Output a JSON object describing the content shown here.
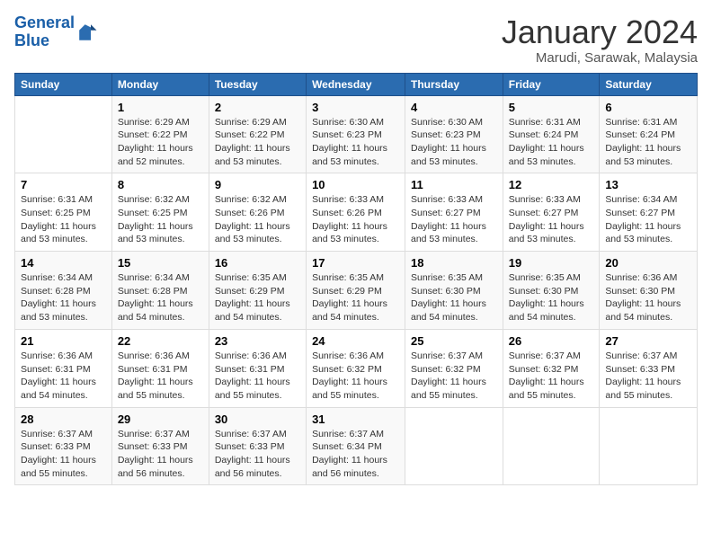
{
  "logo": {
    "line1": "General",
    "line2": "Blue"
  },
  "title": "January 2024",
  "subtitle": "Marudi, Sarawak, Malaysia",
  "weekdays": [
    "Sunday",
    "Monday",
    "Tuesday",
    "Wednesday",
    "Thursday",
    "Friday",
    "Saturday"
  ],
  "weeks": [
    [
      {
        "day": "",
        "info": ""
      },
      {
        "day": "1",
        "info": "Sunrise: 6:29 AM\nSunset: 6:22 PM\nDaylight: 11 hours\nand 52 minutes."
      },
      {
        "day": "2",
        "info": "Sunrise: 6:29 AM\nSunset: 6:22 PM\nDaylight: 11 hours\nand 53 minutes."
      },
      {
        "day": "3",
        "info": "Sunrise: 6:30 AM\nSunset: 6:23 PM\nDaylight: 11 hours\nand 53 minutes."
      },
      {
        "day": "4",
        "info": "Sunrise: 6:30 AM\nSunset: 6:23 PM\nDaylight: 11 hours\nand 53 minutes."
      },
      {
        "day": "5",
        "info": "Sunrise: 6:31 AM\nSunset: 6:24 PM\nDaylight: 11 hours\nand 53 minutes."
      },
      {
        "day": "6",
        "info": "Sunrise: 6:31 AM\nSunset: 6:24 PM\nDaylight: 11 hours\nand 53 minutes."
      }
    ],
    [
      {
        "day": "7",
        "info": ""
      },
      {
        "day": "8",
        "info": "Sunrise: 6:32 AM\nSunset: 6:25 PM\nDaylight: 11 hours\nand 53 minutes."
      },
      {
        "day": "9",
        "info": "Sunrise: 6:32 AM\nSunset: 6:26 PM\nDaylight: 11 hours\nand 53 minutes."
      },
      {
        "day": "10",
        "info": "Sunrise: 6:33 AM\nSunset: 6:26 PM\nDaylight: 11 hours\nand 53 minutes."
      },
      {
        "day": "11",
        "info": "Sunrise: 6:33 AM\nSunset: 6:27 PM\nDaylight: 11 hours\nand 53 minutes."
      },
      {
        "day": "12",
        "info": "Sunrise: 6:33 AM\nSunset: 6:27 PM\nDaylight: 11 hours\nand 53 minutes."
      },
      {
        "day": "13",
        "info": "Sunrise: 6:34 AM\nSunset: 6:27 PM\nDaylight: 11 hours\nand 53 minutes."
      }
    ],
    [
      {
        "day": "14",
        "info": ""
      },
      {
        "day": "15",
        "info": "Sunrise: 6:34 AM\nSunset: 6:28 PM\nDaylight: 11 hours\nand 54 minutes."
      },
      {
        "day": "16",
        "info": "Sunrise: 6:35 AM\nSunset: 6:29 PM\nDaylight: 11 hours\nand 54 minutes."
      },
      {
        "day": "17",
        "info": "Sunrise: 6:35 AM\nSunset: 6:29 PM\nDaylight: 11 hours\nand 54 minutes."
      },
      {
        "day": "18",
        "info": "Sunrise: 6:35 AM\nSunset: 6:30 PM\nDaylight: 11 hours\nand 54 minutes."
      },
      {
        "day": "19",
        "info": "Sunrise: 6:35 AM\nSunset: 6:30 PM\nDaylight: 11 hours\nand 54 minutes."
      },
      {
        "day": "20",
        "info": "Sunrise: 6:36 AM\nSunset: 6:30 PM\nDaylight: 11 hours\nand 54 minutes."
      }
    ],
    [
      {
        "day": "21",
        "info": ""
      },
      {
        "day": "22",
        "info": "Sunrise: 6:36 AM\nSunset: 6:31 PM\nDaylight: 11 hours\nand 55 minutes."
      },
      {
        "day": "23",
        "info": "Sunrise: 6:36 AM\nSunset: 6:31 PM\nDaylight: 11 hours\nand 55 minutes."
      },
      {
        "day": "24",
        "info": "Sunrise: 6:36 AM\nSunset: 6:32 PM\nDaylight: 11 hours\nand 55 minutes."
      },
      {
        "day": "25",
        "info": "Sunrise: 6:37 AM\nSunset: 6:32 PM\nDaylight: 11 hours\nand 55 minutes."
      },
      {
        "day": "26",
        "info": "Sunrise: 6:37 AM\nSunset: 6:32 PM\nDaylight: 11 hours\nand 55 minutes."
      },
      {
        "day": "27",
        "info": "Sunrise: 6:37 AM\nSunset: 6:33 PM\nDaylight: 11 hours\nand 55 minutes."
      }
    ],
    [
      {
        "day": "28",
        "info": "Sunrise: 6:37 AM\nSunset: 6:33 PM\nDaylight: 11 hours\nand 55 minutes."
      },
      {
        "day": "29",
        "info": "Sunrise: 6:37 AM\nSunset: 6:33 PM\nDaylight: 11 hours\nand 56 minutes."
      },
      {
        "day": "30",
        "info": "Sunrise: 6:37 AM\nSunset: 6:33 PM\nDaylight: 11 hours\nand 56 minutes."
      },
      {
        "day": "31",
        "info": "Sunrise: 6:37 AM\nSunset: 6:34 PM\nDaylight: 11 hours\nand 56 minutes."
      },
      {
        "day": "",
        "info": ""
      },
      {
        "day": "",
        "info": ""
      },
      {
        "day": "",
        "info": ""
      }
    ]
  ],
  "week1_day7_info": "Sunrise: 6:31 AM\nSunset: 6:25 PM\nDaylight: 11 hours\nand 53 minutes.",
  "week2_day14_info": "Sunrise: 6:34 AM\nSunset: 6:28 PM\nDaylight: 11 hours\nand 53 minutes.",
  "week3_day21_info": "Sunrise: 6:36 AM\nSunset: 6:31 PM\nDaylight: 11 hours\nand 54 minutes."
}
